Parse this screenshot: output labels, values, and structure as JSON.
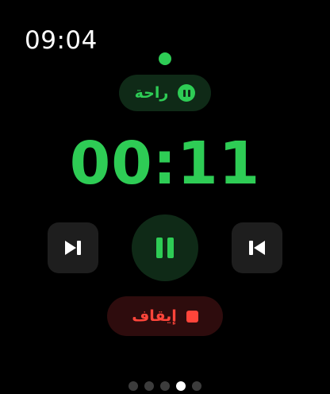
{
  "status_bar": {
    "time": "09:04"
  },
  "mode": {
    "label": "راحة",
    "icon": "pause-circle-icon",
    "accent_color": "#2ecc55"
  },
  "timer": {
    "elapsed": "00:11"
  },
  "controls": {
    "left_icon": "next-track-icon",
    "center_icon": "pause-icon",
    "right_icon": "previous-track-icon"
  },
  "stop_button": {
    "label": "إيقاف",
    "icon": "stop-square-icon",
    "color": "#ff453a"
  },
  "pager": {
    "total": 5,
    "active_index": 3
  }
}
